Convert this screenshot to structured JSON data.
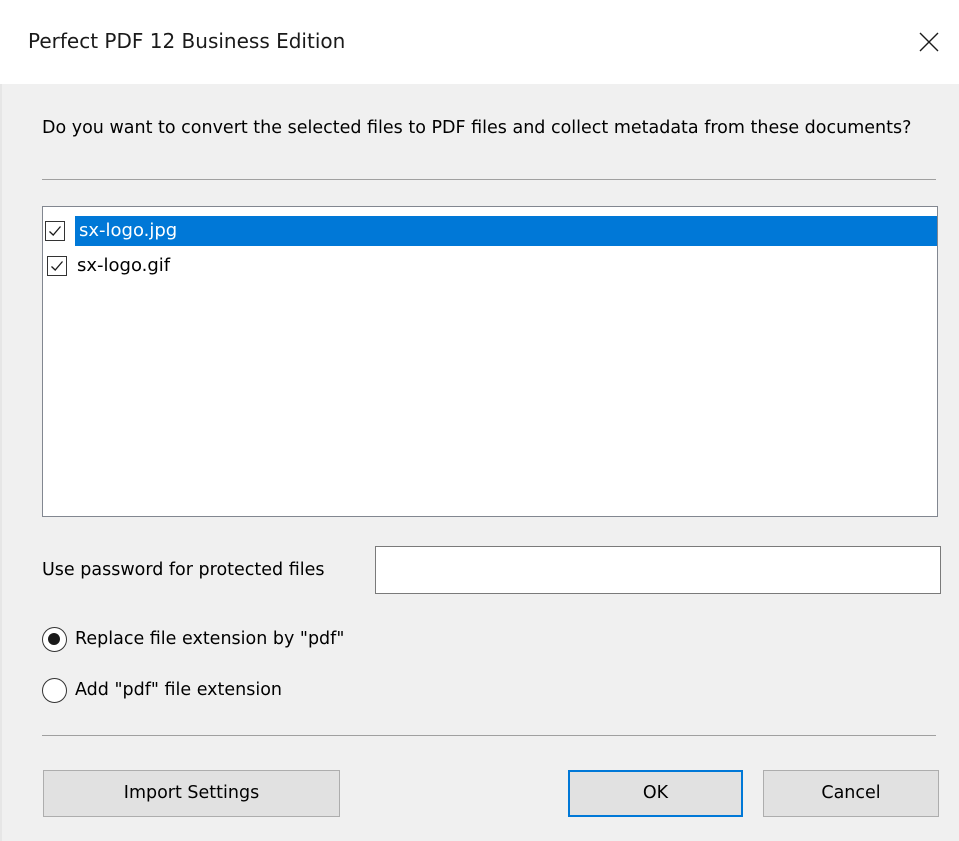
{
  "window": {
    "title": "Perfect PDF 12 Business Edition",
    "close_icon": "close-icon"
  },
  "dialog": {
    "question": "Do you want to convert the selected files to PDF files and collect metadata from these documents?",
    "files": [
      {
        "name": "sx-logo.jpg",
        "checked": true,
        "selected": true
      },
      {
        "name": "sx-logo.gif",
        "checked": true,
        "selected": false
      }
    ],
    "password_label": "Use password for protected files",
    "password_value": "",
    "options": [
      {
        "label": "Replace file extension by \"pdf\"",
        "selected": true
      },
      {
        "label": "Add \"pdf\" file extension",
        "selected": false
      }
    ],
    "buttons": {
      "import": "Import Settings",
      "ok": "OK",
      "cancel": "Cancel"
    }
  },
  "colors": {
    "selection": "#0078d7",
    "dialog_background": "#f0f0f0",
    "button_face": "#e1e1e1",
    "default_button_border": "#0078d7"
  }
}
